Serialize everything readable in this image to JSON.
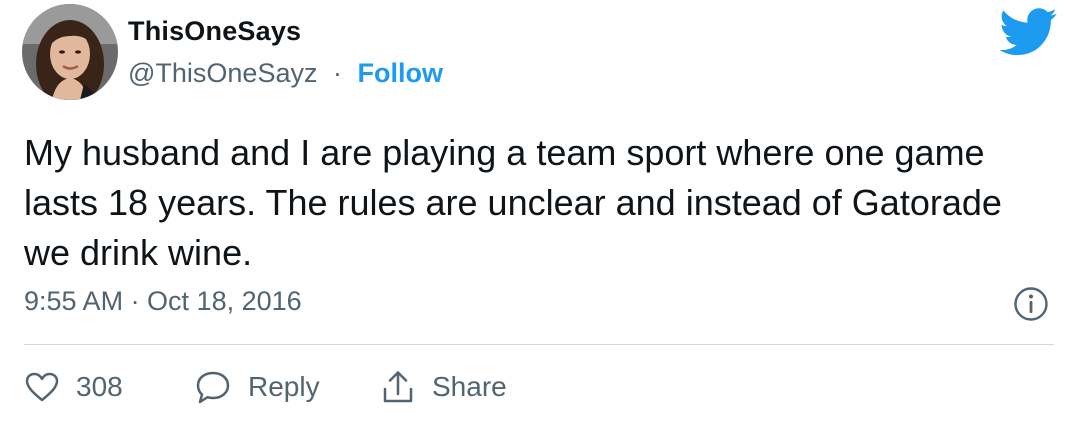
{
  "author": {
    "display_name": "ThisOneSays",
    "handle": "@ThisOneSayz",
    "separator": "·",
    "follow_label": "Follow"
  },
  "tweet": {
    "text": "My husband and I are playing a team sport where one game lasts 18 years. The rules are unclear and instead of Gatorade we drink wine.",
    "timestamp": "9:55 AM · Oct 18, 2016"
  },
  "actions": {
    "like_count": "308",
    "reply_label": "Reply",
    "share_label": "Share"
  },
  "icons": {
    "brand": "twitter-bird-icon",
    "info": "info-icon",
    "like": "heart-icon",
    "reply": "speech-bubble-icon",
    "share": "share-arrow-icon"
  },
  "colors": {
    "brand_blue": "#1d9bf0",
    "text_primary": "#0f1419",
    "text_secondary": "#536471",
    "divider": "#cfd9de"
  }
}
